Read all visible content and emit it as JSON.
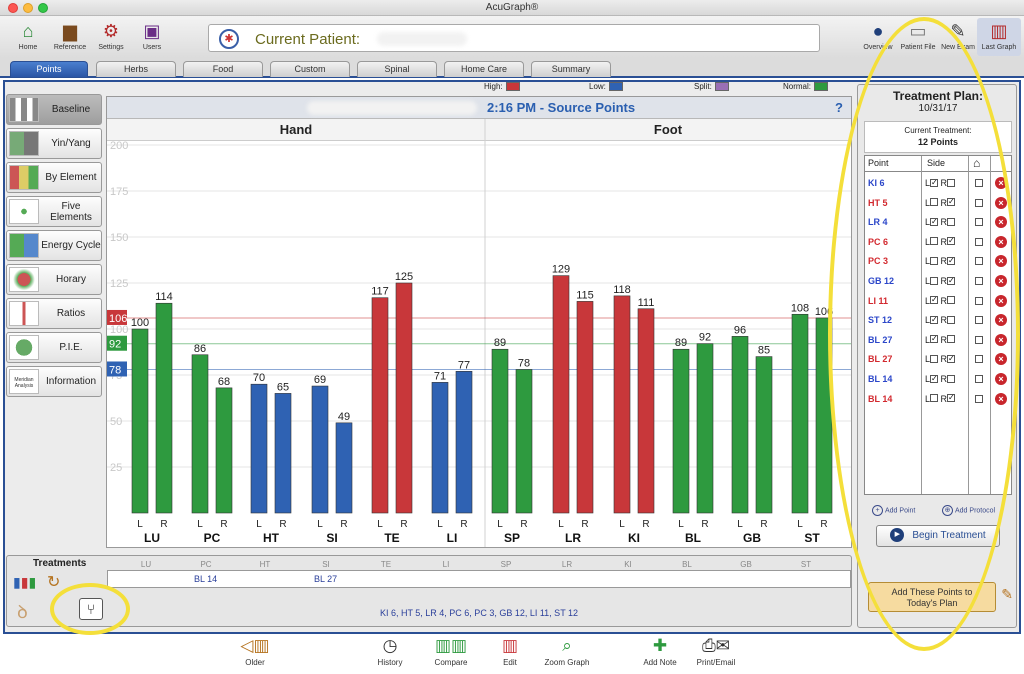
{
  "window_title": "AcuGraph®",
  "toolbar": {
    "left": [
      {
        "name": "home-button",
        "icon": "house-icon",
        "label": "Home"
      },
      {
        "name": "reference-button",
        "icon": "book-icon",
        "label": "Reference"
      },
      {
        "name": "settings-button",
        "icon": "gears-icon",
        "label": "Settings"
      },
      {
        "name": "users-button",
        "icon": "briefcase-icon",
        "label": "Users"
      }
    ],
    "right": [
      {
        "name": "overview-button",
        "icon": "person-icon",
        "label": "Overview"
      },
      {
        "name": "patient-file-button",
        "icon": "folder-icon",
        "label": "Patient File"
      },
      {
        "name": "new-exam-button",
        "icon": "probe-icon",
        "label": "New Exam"
      },
      {
        "name": "last-graph-button",
        "icon": "bar-graph-icon",
        "label": "Last Graph"
      }
    ],
    "patient_label": "Current Patient:"
  },
  "tabs": [
    {
      "label": "Points",
      "active": true
    },
    {
      "label": "Herbs"
    },
    {
      "label": "Food"
    },
    {
      "label": "Custom"
    },
    {
      "label": "Spinal"
    },
    {
      "label": "Home Care"
    },
    {
      "label": "Summary"
    }
  ],
  "sidebar": [
    {
      "label": "Baseline",
      "active": true
    },
    {
      "label": "Yin/Yang"
    },
    {
      "label": "By Element"
    },
    {
      "label": "Five Elements"
    },
    {
      "label": "Energy Cycle"
    },
    {
      "label": "Horary"
    },
    {
      "label": "Ratios"
    },
    {
      "label": "P.I.E."
    },
    {
      "label": "Information",
      "thumb_text": "Meridian Analysis"
    }
  ],
  "legend": [
    {
      "label": "High:",
      "color": "#c8373a"
    },
    {
      "label": "Low:",
      "color": "#2f62b3"
    },
    {
      "label": "Split:",
      "color": "#9a6fb5"
    },
    {
      "label": "Normal:",
      "color": "#2e9a3f"
    }
  ],
  "colors": {
    "high": "#c8373a",
    "low": "#2f62b3",
    "normal": "#2e9a3f",
    "accent": "#2a4f94",
    "annotation": "#f4df3a"
  },
  "chart_data": {
    "type": "bar",
    "title": "2:16 PM - Source Points",
    "help": "?",
    "panels": [
      "Hand",
      "Foot"
    ],
    "ylim": [
      0,
      200
    ],
    "yticks": [
      25,
      50,
      75,
      100,
      125,
      150,
      175,
      200
    ],
    "reference_lines": [
      {
        "value": 106,
        "label": "106",
        "kind": "high"
      },
      {
        "value": 92,
        "label": "92",
        "kind": "normal"
      },
      {
        "value": 78,
        "label": "78",
        "kind": "low"
      }
    ],
    "side_labels": [
      "L",
      "R"
    ],
    "categories": [
      "LU",
      "PC",
      "HT",
      "SI",
      "TE",
      "LI",
      "SP",
      "LR",
      "KI",
      "BL",
      "GB",
      "ST"
    ],
    "series": [
      {
        "name": "L",
        "values": [
          100,
          86,
          70,
          69,
          117,
          71,
          89,
          129,
          118,
          89,
          96,
          108
        ]
      },
      {
        "name": "R",
        "values": [
          114,
          68,
          65,
          49,
          125,
          77,
          78,
          115,
          111,
          92,
          85,
          106
        ]
      }
    ],
    "bar_status": [
      [
        "normal",
        "normal"
      ],
      [
        "normal",
        "normal"
      ],
      [
        "low",
        "low"
      ],
      [
        "low",
        "low"
      ],
      [
        "high",
        "high"
      ],
      [
        "low",
        "low"
      ],
      [
        "normal",
        "normal"
      ],
      [
        "high",
        "high"
      ],
      [
        "high",
        "high"
      ],
      [
        "normal",
        "normal"
      ],
      [
        "normal",
        "normal"
      ],
      [
        "normal",
        "normal"
      ]
    ]
  },
  "treatment_plan": {
    "title": "Treatment Plan:",
    "date": "10/31/17",
    "current_label": "Current Treatment:",
    "current_count": "12 Points",
    "col_point": "Point",
    "col_side": "Side",
    "col_home_icon": "house-icon",
    "side_l": "L",
    "side_r": "R",
    "rows": [
      {
        "point": "KI 6",
        "color": "#2b46c9",
        "l": true,
        "r": false,
        "home": false
      },
      {
        "point": "HT 5",
        "color": "#d2282e",
        "l": false,
        "r": true,
        "home": false
      },
      {
        "point": "LR 4",
        "color": "#2b46c9",
        "l": true,
        "r": false,
        "home": false
      },
      {
        "point": "PC 6",
        "color": "#d2282e",
        "l": false,
        "r": true,
        "home": false
      },
      {
        "point": "PC 3",
        "color": "#d2282e",
        "l": false,
        "r": true,
        "home": false
      },
      {
        "point": "GB 12",
        "color": "#2b46c9",
        "l": false,
        "r": true,
        "home": false
      },
      {
        "point": "LI 11",
        "color": "#d2282e",
        "l": true,
        "r": false,
        "home": false
      },
      {
        "point": "ST 12",
        "color": "#2b46c9",
        "l": true,
        "r": false,
        "home": false
      },
      {
        "point": "BL 27",
        "color": "#2b46c9",
        "l": true,
        "r": false,
        "home": false
      },
      {
        "point": "BL 27",
        "color": "#d2282e",
        "l": false,
        "r": true,
        "home": false
      },
      {
        "point": "BL 14",
        "color": "#2b46c9",
        "l": true,
        "r": false,
        "home": false
      },
      {
        "point": "BL 14",
        "color": "#d2282e",
        "l": false,
        "r": true,
        "home": false
      }
    ],
    "add_point": "Add Point",
    "add_protocol": "Add Protocol",
    "begin": "Begin Treatment",
    "add_today": "Add These Points to Today's Plan"
  },
  "treatments": {
    "title": "Treatments",
    "cols": [
      "LU",
      "PC",
      "HT",
      "SI",
      "TE",
      "LI",
      "SP",
      "LR",
      "KI",
      "BL",
      "GB",
      "ST"
    ],
    "row1": [
      {
        "col": 1,
        "text": "BL 14"
      },
      {
        "col": 3,
        "text": "BL 27"
      }
    ],
    "summary": "KI 6, HT 5, LR 4, PC 6, PC 3, GB 12, LI 11, ST 12"
  },
  "bottom_buttons": [
    {
      "name": "older-button",
      "icon": "older-graph-icon",
      "label": "Older"
    },
    {
      "name": "history-button",
      "icon": "clock-icon",
      "label": "History"
    },
    {
      "name": "compare-button",
      "icon": "compare-icon",
      "label": "Compare"
    },
    {
      "name": "edit-button",
      "icon": "edit-graph-icon",
      "label": "Edit"
    },
    {
      "name": "zoom-graph-button",
      "icon": "magnifier-icon",
      "label": "Zoom Graph"
    },
    {
      "name": "add-note-button",
      "icon": "note-icon",
      "label": "Add Note"
    },
    {
      "name": "print-email-button",
      "icon": "printer-icon",
      "label": "Print/Email"
    }
  ]
}
